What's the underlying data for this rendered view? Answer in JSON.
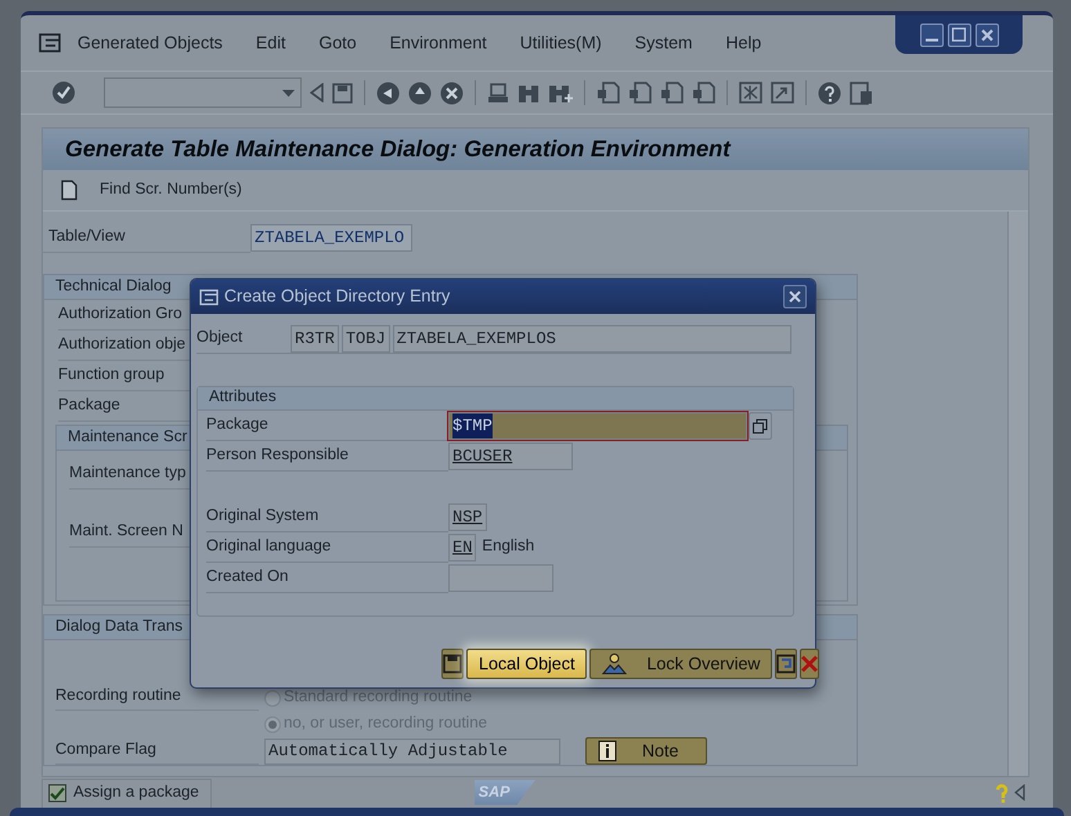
{
  "menu": [
    "Generated Objects",
    "Edit",
    "Goto",
    "Environment",
    "Utilities(M)",
    "System",
    "Help"
  ],
  "screen": {
    "title": "Generate Table Maintenance Dialog: Generation Environment",
    "app_toolbar": [
      "Find Scr. Number(s)"
    ],
    "table_view": {
      "label": "Table/View",
      "value": "ZTABELA_EXEMPLO"
    },
    "technical_group": {
      "title": "Technical Dialog",
      "fields": [
        "Authorization Gro",
        "Authorization obje",
        "Function group",
        "Package"
      ],
      "maintenance_screens": {
        "title": "Maintenance Scr",
        "fields": [
          "Maintenance typ",
          "Maint. Screen N"
        ]
      }
    },
    "data_transport": {
      "title": "Dialog Data Trans",
      "recording_label": "Recording routine",
      "options": [
        {
          "label": "Standard recording routine",
          "selected": false
        },
        {
          "label": "no, or user, recording routine",
          "selected": true
        }
      ],
      "compare_label": "Compare Flag",
      "compare_value": "Automatically Adjustable",
      "note_button": "Note"
    }
  },
  "dialog": {
    "title": "Create Object Directory Entry",
    "object": {
      "label": "Object",
      "values": [
        "R3TR",
        "TOBJ",
        "ZTABELA_EXEMPLOS"
      ]
    },
    "attributes": {
      "title": "Attributes",
      "fields": [
        {
          "label": "Package",
          "value": "$TMP",
          "focused": true
        },
        {
          "label": "Person Responsible",
          "value": "BCUSER",
          "focused": false
        },
        {
          "label": "Original System",
          "value": "NSP",
          "focused": false
        },
        {
          "label": "Original language",
          "value": "EN",
          "description": "English",
          "focused": false
        },
        {
          "label": "Created On",
          "focused": false
        }
      ]
    },
    "buttons": [
      {
        "label": "Local Object",
        "focused": true
      },
      {
        "label": "Lock Overview",
        "focused": false
      }
    ]
  },
  "status_bar": {
    "checkbox": {
      "label": "Assign a package",
      "checked": true
    },
    "logo": "SAP"
  }
}
